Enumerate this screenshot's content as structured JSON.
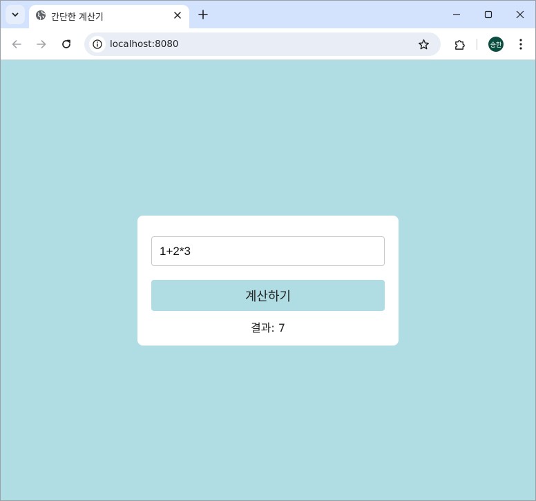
{
  "browser": {
    "tab": {
      "title": "간단한 계산기"
    },
    "address_bar": {
      "url": "localhost:8080"
    },
    "profile": {
      "initials": "승한"
    }
  },
  "icons": {
    "tab_search": "chevron-down-icon",
    "favicon": "globe-icon",
    "tab_close": "close-icon",
    "new_tab": "plus-icon",
    "minimize": "minimize-icon",
    "maximize": "maximize-icon",
    "close": "close-icon",
    "back": "arrow-left-icon",
    "forward": "arrow-right-icon",
    "reload": "reload-icon",
    "site_info": "info-icon",
    "bookmark": "star-icon",
    "extensions": "puzzle-icon",
    "menu": "kebab-menu-icon"
  },
  "colors": {
    "page_background": "#b0dde4",
    "card_background": "#ffffff",
    "button_background": "#b0dde4",
    "browser_frame": "#d3e3fd"
  },
  "calculator": {
    "expression": "1+2*3",
    "button_label": "계산하기",
    "result_text": "결과: 7"
  }
}
